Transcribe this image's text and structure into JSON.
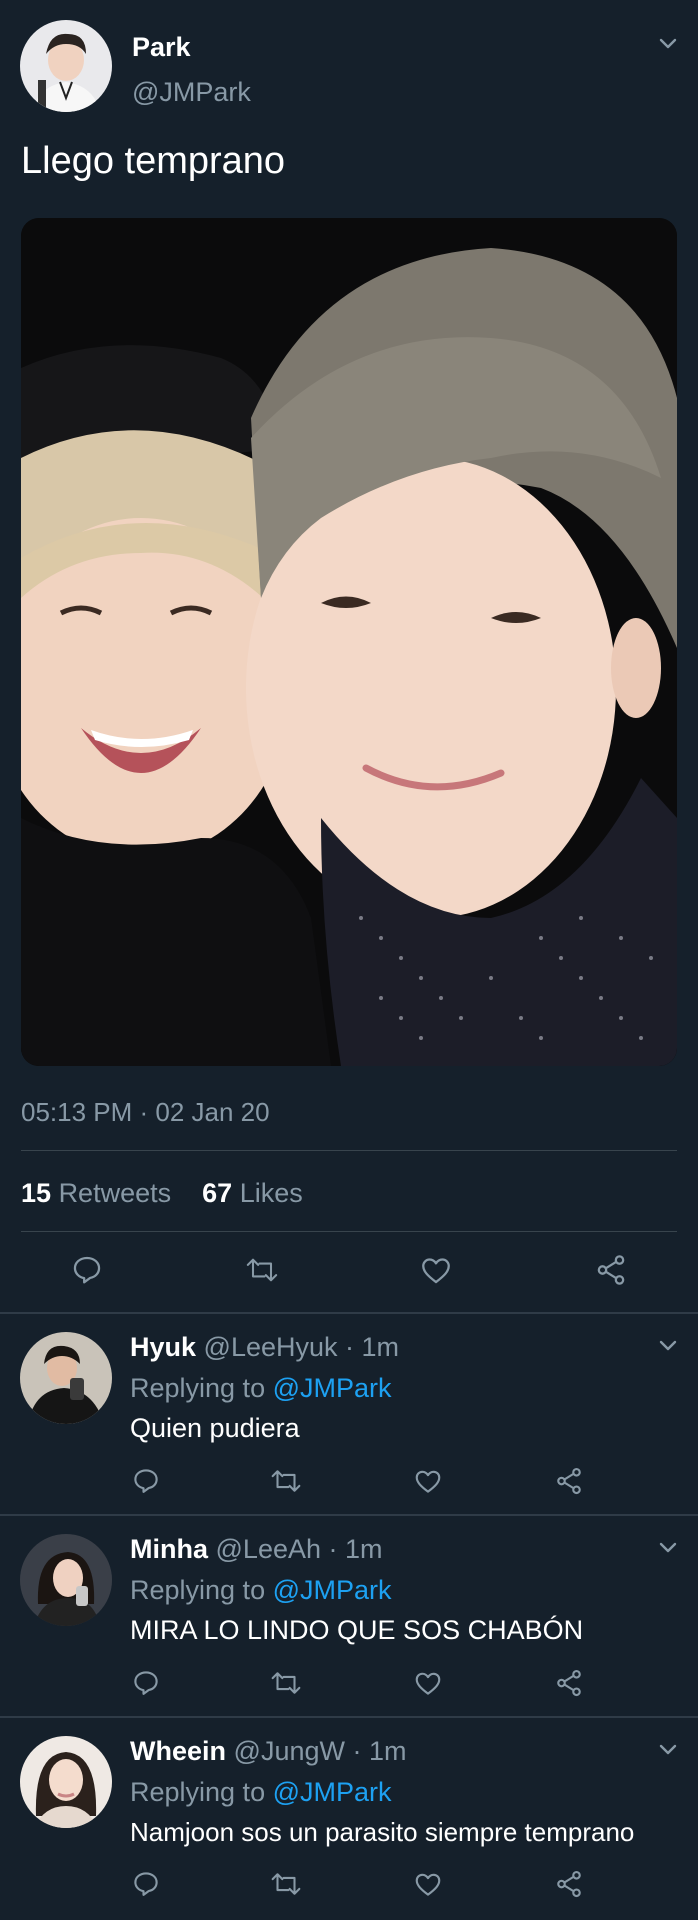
{
  "main_tweet": {
    "author_name": "Park",
    "author_handle": "@JMPark",
    "text": "Llego temprano",
    "timestamp": "05:13 PM · 02 Jan 20",
    "retweets_count": "15",
    "retweets_label": "Retweets",
    "likes_count": "67",
    "likes_label": "Likes"
  },
  "replies": [
    {
      "name": "Hyuk",
      "handle": "@LeeHyuk",
      "time": "· 1m",
      "replying_prefix": "Replying to",
      "replying_to": "@JMPark",
      "text": "Quien pudiera"
    },
    {
      "name": "Minha",
      "handle": "@LeeAh",
      "time": "· 1m",
      "replying_prefix": "Replying to",
      "replying_to": "@JMPark",
      "text": "MIRA LO LINDO QUE SOS CHABÓN"
    },
    {
      "name": "Wheein",
      "handle": "@JungW",
      "time": "· 1m",
      "replying_prefix": "Replying to",
      "replying_to": "@JMPark",
      "text": "Namjoon sos un parasito siempre temprano"
    }
  ],
  "icons": {
    "reply": "reply-icon",
    "retweet": "retweet-icon",
    "like": "heart-icon",
    "share": "share-icon",
    "menu": "chevron-down-icon"
  },
  "colors": {
    "background": "#15202b",
    "text": "#ffffff",
    "muted": "#8899a6",
    "accent": "#1da1f2",
    "divider": "#38444d"
  }
}
